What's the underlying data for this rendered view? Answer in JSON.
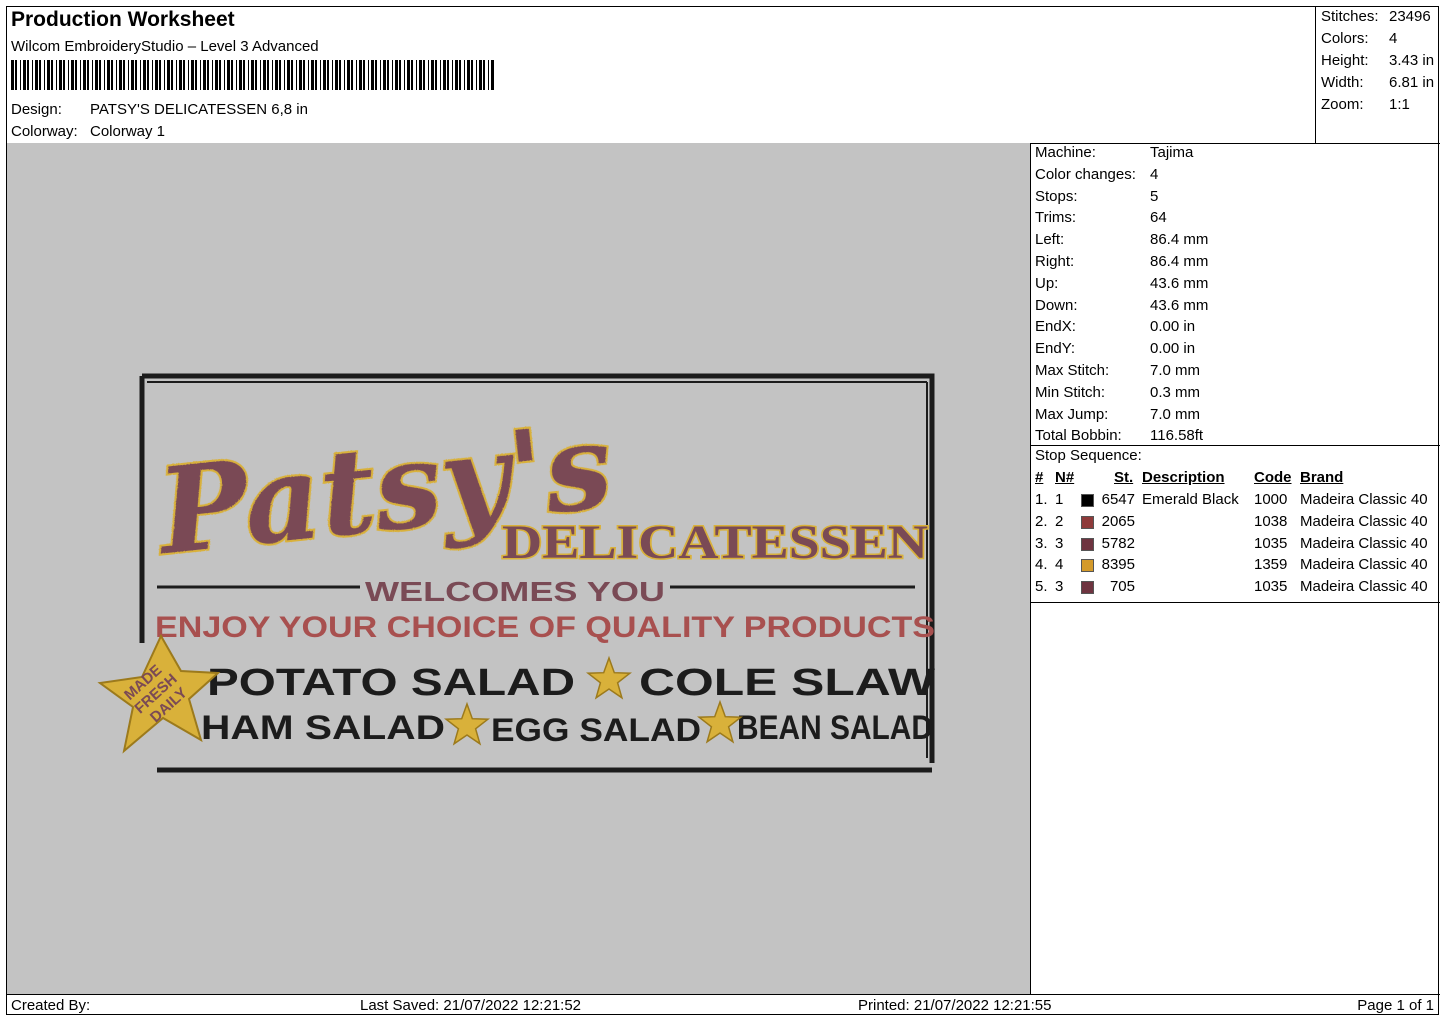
{
  "header": {
    "title": "Production Worksheet",
    "subtitle": "Wilcom EmbroideryStudio – Level 3 Advanced",
    "design_label": "Design:",
    "design_value": "PATSY'S DELICATESSEN 6,8 in",
    "colorway_label": "Colorway:",
    "colorway_value": "Colorway 1"
  },
  "stats": {
    "stitches_label": "Stitches:",
    "stitches": "23496",
    "colors_label": "Colors:",
    "colors": "4",
    "height_label": "Height:",
    "height": "3.43 in",
    "width_label": "Width:",
    "width": "6.81 in",
    "zoom_label": "Zoom:",
    "zoom": "1:1"
  },
  "machine": [
    {
      "label": "Machine:",
      "value": "Tajima"
    },
    {
      "label": "Color changes:",
      "value": "4"
    },
    {
      "label": "Stops:",
      "value": "5"
    },
    {
      "label": "Trims:",
      "value": "64"
    },
    {
      "label": "Left:",
      "value": "86.4 mm"
    },
    {
      "label": "Right:",
      "value": "86.4 mm"
    },
    {
      "label": "Up:",
      "value": "43.6 mm"
    },
    {
      "label": "Down:",
      "value": "43.6 mm"
    },
    {
      "label": "EndX:",
      "value": "0.00 in"
    },
    {
      "label": "EndY:",
      "value": "0.00 in"
    },
    {
      "label": "Max Stitch:",
      "value": "7.0 mm"
    },
    {
      "label": "Min Stitch:",
      "value": "0.3 mm"
    },
    {
      "label": "Max Jump:",
      "value": "7.0 mm"
    },
    {
      "label": "Total Bobbin:",
      "value": "116.58ft"
    }
  ],
  "stop_sequence": {
    "title": "Stop Sequence:",
    "columns": {
      "num": "#",
      "n": "N#",
      "st": "St.",
      "desc": "Description",
      "code": "Code",
      "brand": "Brand"
    },
    "rows": [
      {
        "num": "1.",
        "n": "1",
        "color": "#000000",
        "st": "6547",
        "desc": "Emerald Black",
        "code": "1000",
        "brand": "Madeira Classic 40"
      },
      {
        "num": "2.",
        "n": "2",
        "color": "#8e3a3a",
        "st": "2065",
        "desc": "",
        "code": "1038",
        "brand": "Madeira Classic 40"
      },
      {
        "num": "3.",
        "n": "3",
        "color": "#6e3440",
        "st": "5782",
        "desc": "",
        "code": "1035",
        "brand": "Madeira Classic 40"
      },
      {
        "num": "4.",
        "n": "4",
        "color": "#d49a2a",
        "st": "8395",
        "desc": "",
        "code": "1359",
        "brand": "Madeira Classic 40"
      },
      {
        "num": "5.",
        "n": "3",
        "color": "#6e3440",
        "st": "705",
        "desc": "",
        "code": "1035",
        "brand": "Madeira Classic 40"
      }
    ]
  },
  "design_art": {
    "brand_script": "Patsy's",
    "brand_block": "DELICATESSEN",
    "welcome": "WELCOMES YOU",
    "tagline": "ENJOY  YOUR CHOICE OF QUALITY PRODUCTS",
    "line1_a": "POTATO SALAD",
    "line1_b": "COLE SLAW",
    "line2_a": "HAM SALAD",
    "line2_b": "EGG SALAD",
    "line2_c": "BEAN SALAD",
    "badge_1": "MADE",
    "badge_2": "FRESH",
    "badge_3": "DAILY",
    "colors": {
      "black": "#1c1c1c",
      "red": "#a8504f",
      "mauve": "#7a4a55",
      "gold": "#d9b13a",
      "gold_dark": "#9c7a1c"
    }
  },
  "footer": {
    "created": "Created By:",
    "saved": "Last Saved: 21/07/2022 12:21:52",
    "printed": "Printed: 21/07/2022 12:21:55",
    "page": "Page 1 of 1"
  }
}
